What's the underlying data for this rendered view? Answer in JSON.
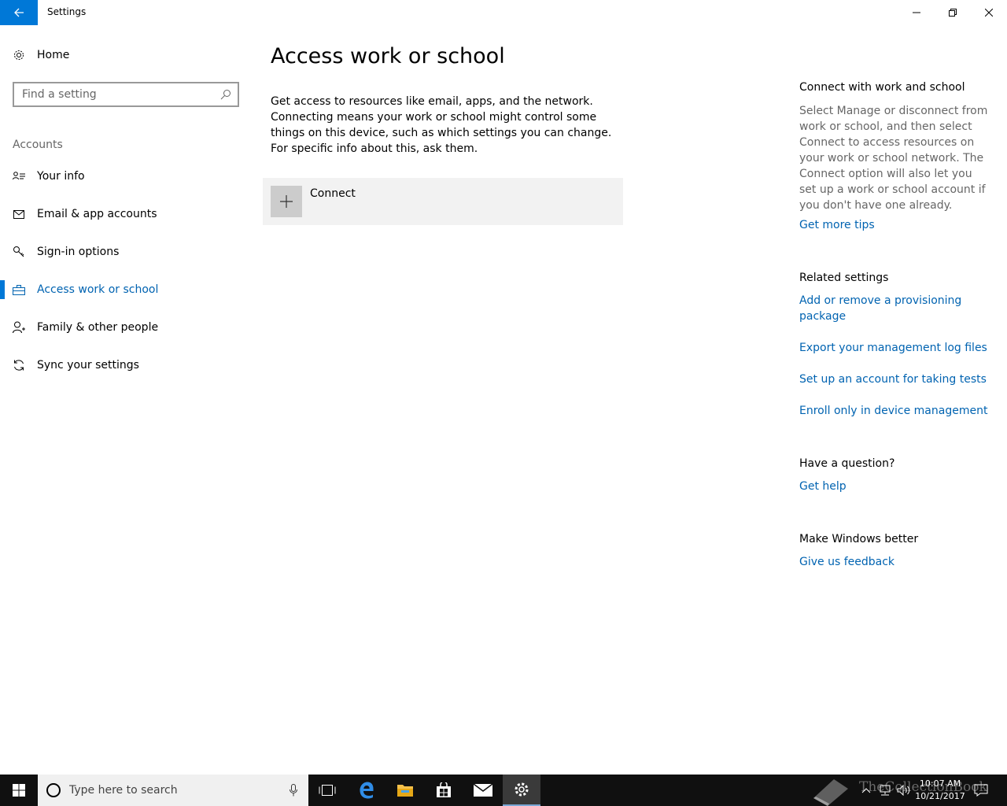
{
  "window": {
    "title": "Settings"
  },
  "sidebar": {
    "home_label": "Home",
    "search_placeholder": "Find a setting",
    "section_label": "Accounts",
    "items": [
      {
        "label": "Your info",
        "icon": "person-card-icon"
      },
      {
        "label": "Email & app accounts",
        "icon": "mail-icon"
      },
      {
        "label": "Sign-in options",
        "icon": "key-icon"
      },
      {
        "label": "Access work or school",
        "icon": "briefcase-icon",
        "active": true
      },
      {
        "label": "Family & other people",
        "icon": "person-add-icon"
      },
      {
        "label": "Sync your settings",
        "icon": "sync-icon"
      }
    ]
  },
  "main": {
    "title": "Access work or school",
    "description": "Get access to resources like email, apps, and the network. Connecting means your work or school might control some things on this device, such as which settings you can change. For specific info about this, ask them.",
    "connect_label": "Connect"
  },
  "right": {
    "connect_heading": "Connect with work and school",
    "connect_text": "Select Manage or disconnect from work or school, and then select Connect to access resources on your work or school network. The Connect option will also let you set up a work or school account if you don't have one already.",
    "tips_link": "Get more tips",
    "related_heading": "Related settings",
    "related_links": [
      "Add or remove a provisioning package",
      "Export your management log files",
      "Set up an account for taking tests",
      "Enroll only in device management"
    ],
    "question_heading": "Have a question?",
    "help_link": "Get help",
    "better_heading": "Make Windows better",
    "feedback_link": "Give us feedback"
  },
  "taskbar": {
    "search_placeholder": "Type here to search",
    "time": "10:07 AM",
    "date": "10/21/2017",
    "watermark": "TheCollectionBook"
  },
  "colors": {
    "accent": "#0078d7",
    "link": "#0063b1",
    "taskbar": "#101010"
  }
}
